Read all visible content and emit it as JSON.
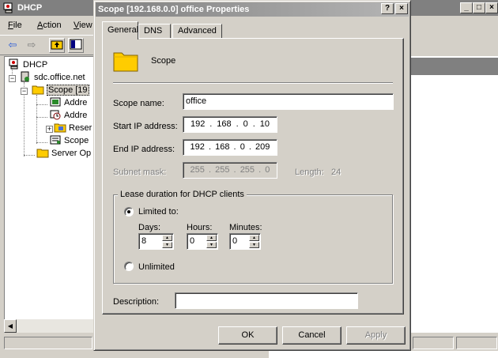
{
  "bg_window": {
    "title": "DHCP",
    "menus": [
      {
        "label": "File"
      },
      {
        "label": "Action"
      },
      {
        "label": "View"
      }
    ],
    "tree": {
      "root": "DHCP",
      "server": "sdc.office.net",
      "scope": "Scope [19",
      "children": [
        "Addre",
        "Addre",
        "Reser",
        "Scope"
      ],
      "server_options": "Server Op"
    }
  },
  "dialog": {
    "title": "Scope [192.168.0.0] office Properties",
    "tabs": [
      "General",
      "DNS",
      "Advanced"
    ],
    "active_tab": "General",
    "header_label": "Scope",
    "scope_name": {
      "label": "Scope name:",
      "value": "office"
    },
    "start_ip": {
      "label": "Start IP address:",
      "octets": [
        "192",
        "168",
        "0",
        "10"
      ]
    },
    "end_ip": {
      "label": "End IP address:",
      "octets": [
        "192",
        "168",
        "0",
        "209"
      ]
    },
    "subnet_mask": {
      "label": "Subnet mask:",
      "octets": [
        "255",
        "255",
        "255",
        "0"
      ],
      "length_label": "Length:",
      "length_value": "24"
    },
    "lease": {
      "group_title": "Lease duration for DHCP clients",
      "limited_label": "Limited to:",
      "unlimited_label": "Unlimited",
      "selected": "limited",
      "days": {
        "label": "Days:",
        "value": "8"
      },
      "hours": {
        "label": "Hours:",
        "value": "0"
      },
      "minutes": {
        "label": "Minutes:",
        "value": "0"
      }
    },
    "description": {
      "label": "Description:",
      "value": ""
    },
    "buttons": {
      "ok": "OK",
      "cancel": "Cancel",
      "apply": "Apply"
    },
    "help_glyph": "?",
    "close_glyph": "×"
  },
  "colors": {
    "dialog_face": "#d4d0c8",
    "title_inactive": "#808080",
    "window_bg": "#ffffff"
  }
}
